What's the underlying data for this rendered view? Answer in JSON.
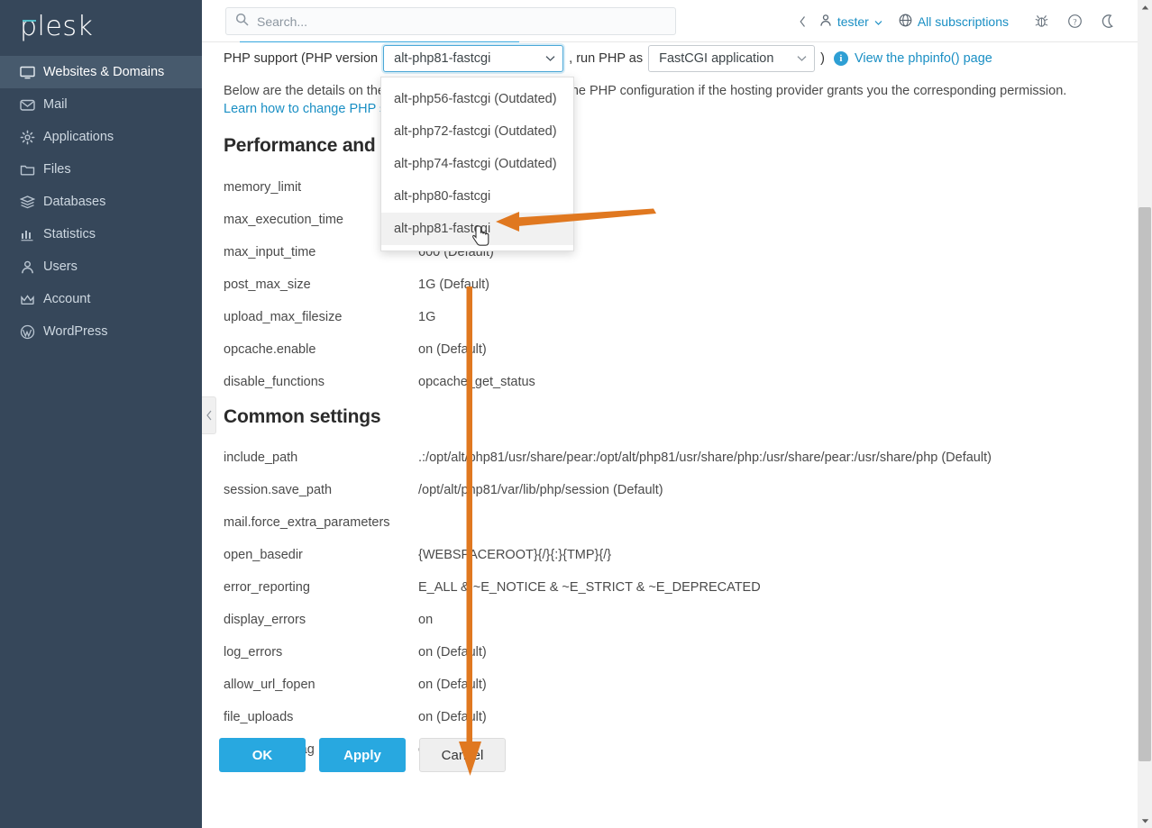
{
  "brand": {
    "name": "plesk",
    "accent": "#53bdc7"
  },
  "colors": {
    "sidebar_bg": "#36475a",
    "sidebar_active": "#475a6d",
    "link": "#1a8fc4",
    "primary_button": "#28a8e0",
    "annotation": "#e07820",
    "focus_border": "#4aa8d8"
  },
  "sidebar": {
    "items": [
      {
        "label": "Websites & Domains",
        "icon": "monitor-icon",
        "active": true
      },
      {
        "label": "Mail",
        "icon": "envelope-icon",
        "active": false
      },
      {
        "label": "Applications",
        "icon": "gear-icon",
        "active": false
      },
      {
        "label": "Files",
        "icon": "folder-icon",
        "active": false
      },
      {
        "label": "Databases",
        "icon": "database-stack-icon",
        "active": false
      },
      {
        "label": "Statistics",
        "icon": "bar-chart-icon",
        "active": false
      },
      {
        "label": "Users",
        "icon": "user-icon",
        "active": false
      },
      {
        "label": "Account",
        "icon": "crown-icon",
        "active": false
      },
      {
        "label": "WordPress",
        "icon": "wordpress-icon",
        "active": false
      }
    ]
  },
  "header": {
    "search_placeholder": "Search...",
    "user_name": "tester",
    "subscriptions_label": "All subscriptions",
    "icons": [
      "bug-icon",
      "help-icon",
      "moon-icon"
    ]
  },
  "php": {
    "label_prefix": "PHP support (PHP version",
    "version_value": "alt-php81-fastcgi",
    "label_middle": ", run PHP as",
    "handler_value": "FastCGI application",
    "label_suffix": ")",
    "phpinfo_link": "View the phpinfo() page",
    "info_icon_char": "i",
    "version_options": [
      {
        "label": "alt-php56-fastcgi (Outdated)",
        "highlighted": false
      },
      {
        "label": "alt-php72-fastcgi (Outdated)",
        "highlighted": false
      },
      {
        "label": "alt-php74-fastcgi (Outdated)",
        "highlighted": false
      },
      {
        "label": "alt-php80-fastcgi",
        "highlighted": false
      },
      {
        "label": "alt-php81-fastcgi",
        "highlighted": true
      }
    ]
  },
  "description": {
    "part1": "Below are the details on the PHP settings. You can change the PHP configuration if the hosting provider grants you the corresponding permission. ",
    "link_text": "Learn how to change PHP settings"
  },
  "sections": [
    {
      "title": "Performance and security settings",
      "rows": [
        {
          "key": "memory_limit",
          "value": ""
        },
        {
          "key": "max_execution_time",
          "value": ""
        },
        {
          "key": "max_input_time",
          "value": "600 (Default)"
        },
        {
          "key": "post_max_size",
          "value": "1G (Default)"
        },
        {
          "key": "upload_max_filesize",
          "value": "1G"
        },
        {
          "key": "opcache.enable",
          "value": "on (Default)"
        },
        {
          "key": "disable_functions",
          "value": "opcache_get_status"
        }
      ]
    },
    {
      "title": "Common settings",
      "rows": [
        {
          "key": "include_path",
          "value": ".:/opt/alt/php81/usr/share/pear:/opt/alt/php81/usr/share/php:/usr/share/pear:/usr/share/php (Default)"
        },
        {
          "key": "session.save_path",
          "value": "/opt/alt/php81/var/lib/php/session (Default)"
        },
        {
          "key": "mail.force_extra_parameters",
          "value": ""
        },
        {
          "key": "open_basedir",
          "value": "{WEBSPACEROOT}{/}{:}{TMP}{/}"
        },
        {
          "key": "error_reporting",
          "value": "E_ALL & ~E_NOTICE & ~E_STRICT & ~E_DEPRECATED"
        },
        {
          "key": "display_errors",
          "value": "on"
        },
        {
          "key": "log_errors",
          "value": "on (Default)"
        },
        {
          "key": "allow_url_fopen",
          "value": "on (Default)"
        },
        {
          "key": "file_uploads",
          "value": "on (Default)"
        },
        {
          "key": "short_open_tag",
          "value": "off (Default)"
        }
      ]
    }
  ],
  "footer": {
    "ok_label": "OK",
    "apply_label": "Apply",
    "cancel_label": "Cancel"
  },
  "annotations": {
    "horizontal_arrow": "points left to the highlighted alt-php81-fastcgi option",
    "vertical_arrow": "points down to the OK button"
  }
}
